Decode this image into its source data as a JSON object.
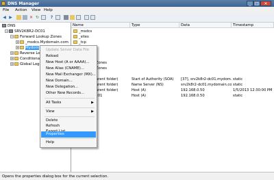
{
  "window": {
    "title": "DNS Manager",
    "controls": [
      "_",
      "□",
      "✕"
    ]
  },
  "menu": [
    "File",
    "Action",
    "View",
    "Help"
  ],
  "tree": {
    "root": "DNS",
    "server": "SRV2K8R2-DC01",
    "forward_zones": "Forward Lookup Zones",
    "zone_msdcs": "_msdcs.Mydomain.com",
    "zone_selected": "Mydom",
    "reverse_zones": "Reverse Lo",
    "conditional": "Conditional",
    "global_logs": "Global Log"
  },
  "list": {
    "columns": [
      "Name",
      "Type",
      "Data",
      "Timestamp"
    ],
    "rows": [
      {
        "name": "_msdcs",
        "type": "",
        "data": "",
        "timestamp": ""
      },
      {
        "name": "_sites",
        "type": "",
        "data": "",
        "timestamp": ""
      },
      {
        "name": "_tcp",
        "type": "",
        "data": "",
        "timestamp": ""
      },
      {
        "name": "",
        "type": "",
        "data": "",
        "timestamp": ""
      },
      {
        "name": "",
        "type": "",
        "data": "",
        "timestamp": ""
      },
      {
        "name": "",
        "type": "",
        "data": "",
        "timestamp": ""
      },
      {
        "name": "Zones",
        "type": "",
        "data": "",
        "timestamp": ""
      },
      {
        "name": "Zones",
        "type": "",
        "data": "",
        "timestamp": ""
      },
      {
        "name": "arent folder)",
        "type": "Start of Authority (SOA)",
        "data": "[37], srv2k8r2-dc01.mydom...",
        "timestamp": "static"
      },
      {
        "name": "arent folder)",
        "type": "Name Server (NS)",
        "data": "srv2k8r2-dc01.mydomain.com.",
        "timestamp": "static"
      },
      {
        "name": "arent folder)",
        "type": "Host (A)",
        "data": "192.168.0.50",
        "timestamp": "1/5/2013 12:30:00 PM"
      },
      {
        "name": "c01",
        "type": "Host (A)",
        "data": "192.168.0.50",
        "timestamp": "static"
      }
    ]
  },
  "context_menu": {
    "items": [
      {
        "label": "Update Server Data File",
        "disabled": true
      },
      {
        "label": "Reload"
      },
      {
        "label": "New Host (A or AAAA)..."
      },
      {
        "label": "New Alias (CNAME)..."
      },
      {
        "label": "New Mail Exchanger (MX)..."
      },
      {
        "label": "New Domain..."
      },
      {
        "label": "New Delegation..."
      },
      {
        "label": "Other New Records..."
      },
      {
        "label": "All Tasks",
        "submenu": true
      },
      {
        "label": "View",
        "submenu": true
      },
      {
        "label": "Delete"
      },
      {
        "label": "Refresh"
      },
      {
        "label": "Export List..."
      },
      {
        "label": "Properties",
        "highlighted": true
      },
      {
        "label": "Help"
      }
    ],
    "submenu_arrow": "▶"
  },
  "status": "Opens the properties dialog box for the current selection.",
  "colors": {
    "selection": "#3399ff",
    "titlebar": "#4a6f9c"
  }
}
